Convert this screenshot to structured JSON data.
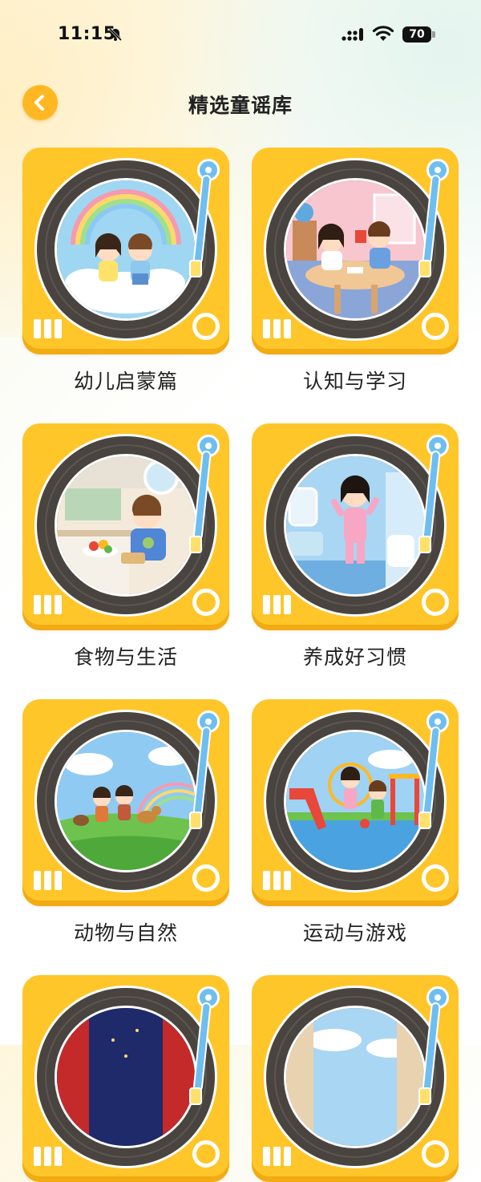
{
  "status_bar": {
    "time": "11:15",
    "battery": "70"
  },
  "header": {
    "title": "精选童谣库"
  },
  "colors": {
    "card": "#ffc62a",
    "accent": "#ffb822",
    "tonearm": "#6fbef0",
    "record": "#4a4440"
  },
  "categories": [
    {
      "label": "幼儿启蒙篇",
      "scene": "kids-on-cloud-with-rainbow"
    },
    {
      "label": "认知与学习",
      "scene": "kids-studying-at-table"
    },
    {
      "label": "食物与生活",
      "scene": "boy-in-kitchen"
    },
    {
      "label": "养成好习惯",
      "scene": "girl-brushing-teeth-bathroom"
    },
    {
      "label": "动物与自然",
      "scene": "kids-with-animals-meadow"
    },
    {
      "label": "运动与游戏",
      "scene": "kids-on-playground"
    },
    {
      "label": "",
      "scene": "stage-night-sky"
    },
    {
      "label": "",
      "scene": "sky-with-clouds"
    }
  ]
}
